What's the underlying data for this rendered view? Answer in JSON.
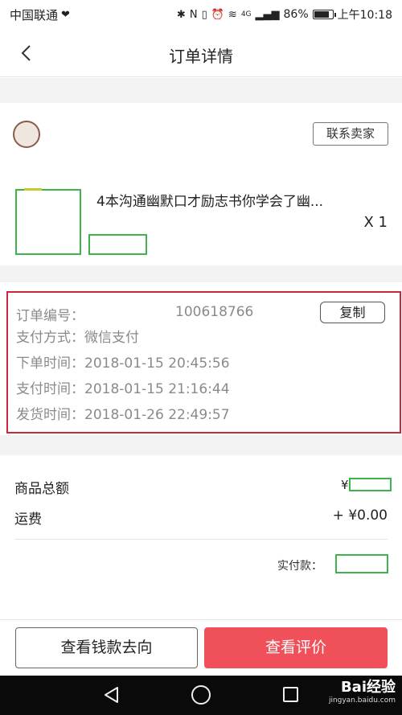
{
  "status_bar": {
    "carrier": "中国联通",
    "network": "4G",
    "battery_text": "86%",
    "battery_level": 0.86,
    "time": "上午10:18"
  },
  "navbar": {
    "title": "订单详情"
  },
  "shop": {
    "contact_label": "联系卖家"
  },
  "product": {
    "title": "4本沟通幽默口才励志书你学会了幽...",
    "quantity": "X 1"
  },
  "order_info": {
    "order_no_label": "订单编号：",
    "order_no": "100618766",
    "copy_label": "复制",
    "pay_method_label": "支付方式：",
    "pay_method": "微信支付",
    "order_time_label": "下单时间：",
    "order_time": "2018-01-15 20:45:56",
    "pay_time_label": "支付时间：",
    "pay_time": "2018-01-15 21:16:44",
    "ship_time_label": "发货时间：",
    "ship_time": "2018-01-26 22:49:57"
  },
  "summary": {
    "goods_total_label": "商品总额",
    "goods_total_currency": "¥",
    "shipping_label": "运费",
    "shipping_value": "+ ¥0.00",
    "paid_label": "实付款："
  },
  "actions": {
    "money_flow_label": "查看钱款去向",
    "review_label": "查看评价"
  },
  "watermark": {
    "brand": "Bai经验",
    "url": "jingyan.baidu.com"
  },
  "colors": {
    "accent": "#f0505a",
    "highlight_frame": "#c8283c",
    "redaction_box": "#3cb44b"
  }
}
